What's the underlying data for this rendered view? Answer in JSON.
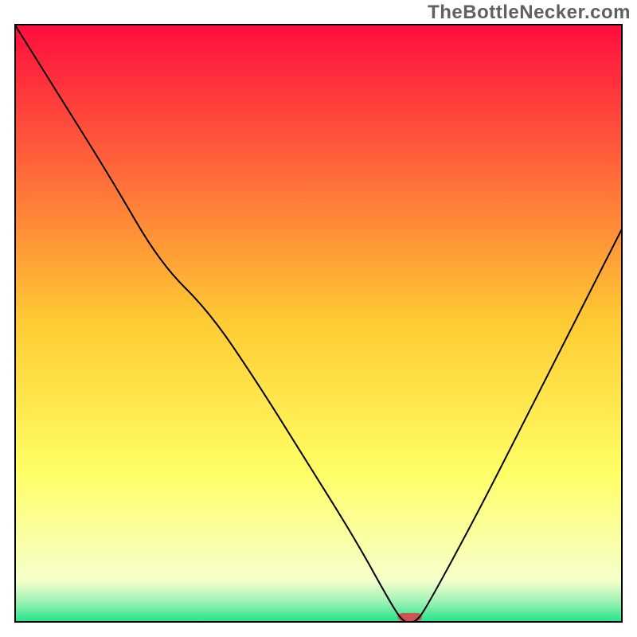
{
  "watermark": "TheBottleNecker.com",
  "chart_data": {
    "type": "line",
    "title": "",
    "xlabel": "",
    "ylabel": "",
    "xlim": [
      0,
      100
    ],
    "ylim": [
      0,
      100
    ],
    "x": [
      0,
      8,
      16,
      24,
      32,
      40,
      48,
      56,
      62,
      64,
      66,
      68,
      76,
      84,
      92,
      100
    ],
    "values": [
      100,
      87,
      74,
      60,
      52,
      40,
      27,
      14,
      3,
      0,
      0,
      3,
      18,
      34,
      50,
      66
    ],
    "background": {
      "type": "vertical-gradient",
      "stops": [
        {
          "pos": 0.0,
          "color": "#ff0d3e"
        },
        {
          "pos": 0.25,
          "color": "#ff6a3a"
        },
        {
          "pos": 0.5,
          "color": "#ffcc33"
        },
        {
          "pos": 0.75,
          "color": "#ffff66"
        },
        {
          "pos": 0.93,
          "color": "#f6ffcc"
        },
        {
          "pos": 0.965,
          "color": "#9df2b4"
        },
        {
          "pos": 1.0,
          "color": "#1ee28a"
        }
      ]
    },
    "marker": {
      "x": 65,
      "y": 0,
      "width": 4,
      "height": 1,
      "color": "#d05252"
    },
    "curve_color": "#000000",
    "curve_width": 2
  }
}
